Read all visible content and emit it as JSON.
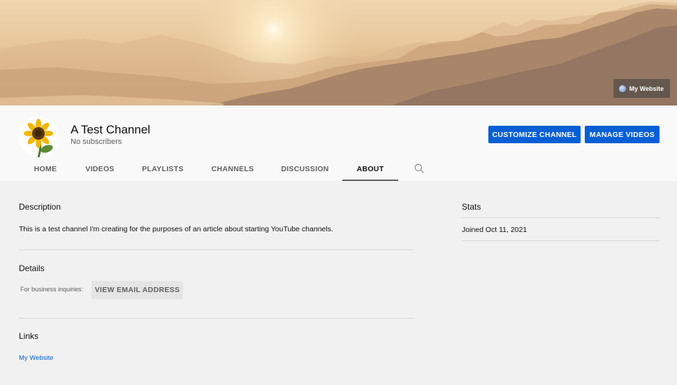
{
  "banner": {
    "link_label": "My Website",
    "link_icon": "globe-icon"
  },
  "channel": {
    "name": "A Test Channel",
    "subscribers": "No subscribers",
    "avatar_icon": "sunflower-avatar"
  },
  "actions": {
    "customize": "CUSTOMIZE CHANNEL",
    "manage": "MANAGE VIDEOS"
  },
  "tabs": [
    {
      "label": "HOME"
    },
    {
      "label": "VIDEOS"
    },
    {
      "label": "PLAYLISTS"
    },
    {
      "label": "CHANNELS"
    },
    {
      "label": "DISCUSSION"
    },
    {
      "label": "ABOUT",
      "active": true
    }
  ],
  "about": {
    "description_title": "Description",
    "description_text": "This is a test channel I'm creating for the purposes of an article about starting YouTube channels.",
    "details_title": "Details",
    "business_label": "For business inquiries:",
    "email_button": "VIEW EMAIL ADDRESS",
    "links_title": "Links",
    "link_website": "My Website"
  },
  "stats": {
    "title": "Stats",
    "joined": "Joined Oct 11, 2021"
  },
  "colors": {
    "accent": "#065fd4",
    "background": "#f1f1f1",
    "header_bg": "#f9f9f9"
  }
}
